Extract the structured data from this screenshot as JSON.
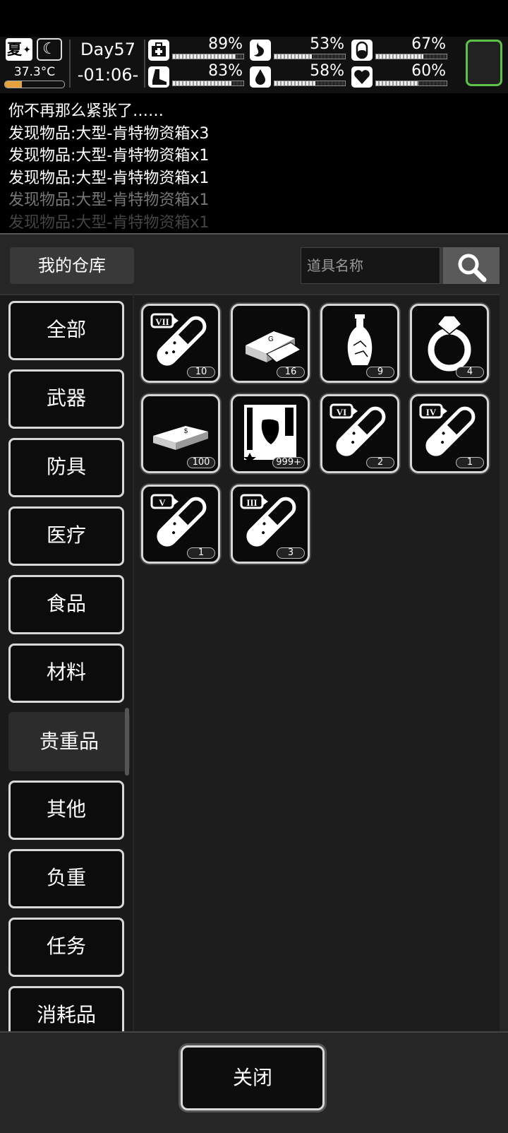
{
  "hud": {
    "season": "夏",
    "temperature": "37.3°C",
    "temperature_level": 0.28,
    "day": "Day57",
    "time": "-01:06-",
    "stats": [
      {
        "icon": "health-icon",
        "value": "89%",
        "level": 0.89
      },
      {
        "icon": "stomach-icon",
        "value": "53%",
        "level": 0.53
      },
      {
        "icon": "pill-icon",
        "value": "67%",
        "level": 0.67
      },
      {
        "icon": "foot-icon",
        "value": "83%",
        "level": 0.83
      },
      {
        "icon": "water-drop-icon",
        "value": "58%",
        "level": 0.58
      },
      {
        "icon": "heart-icon",
        "value": "60%",
        "level": 0.6
      }
    ],
    "accent": "#5ec24a"
  },
  "log": [
    "你不再那么紧张了……",
    "发现物品:大型-肯特物资箱x3",
    "发现物品:大型-肯特物资箱x1",
    "发现物品:大型-肯特物资箱x1",
    "发现物品:大型-肯特物资箱x1",
    "发现物品:大型-肯特物资箱x1"
  ],
  "warehouse": {
    "title": "我的仓库",
    "search_placeholder": "道具名称",
    "categories": [
      "全部",
      "武器",
      "防具",
      "医疗",
      "食品",
      "材料",
      "贵重品",
      "其他",
      "负重",
      "任务",
      "消耗品"
    ],
    "active_category": "贵重品",
    "items": [
      {
        "icon": "test-tube-vii-icon",
        "roman": "VII",
        "count": "10"
      },
      {
        "icon": "gold-bars-icon",
        "count": "16"
      },
      {
        "icon": "vase-icon",
        "count": "9"
      },
      {
        "icon": "diamond-ring-icon",
        "count": "4"
      },
      {
        "icon": "cash-stack-icon",
        "count": "100"
      },
      {
        "icon": "specimen-card-icon",
        "count": "999+"
      },
      {
        "icon": "test-tube-vi-icon",
        "roman": "VI",
        "count": "2"
      },
      {
        "icon": "test-tube-iv-icon",
        "roman": "IV",
        "count": "1"
      },
      {
        "icon": "test-tube-v-icon",
        "roman": "V",
        "count": "1"
      },
      {
        "icon": "test-tube-iii-icon",
        "roman": "III",
        "count": "3"
      }
    ],
    "close_label": "关闭"
  }
}
